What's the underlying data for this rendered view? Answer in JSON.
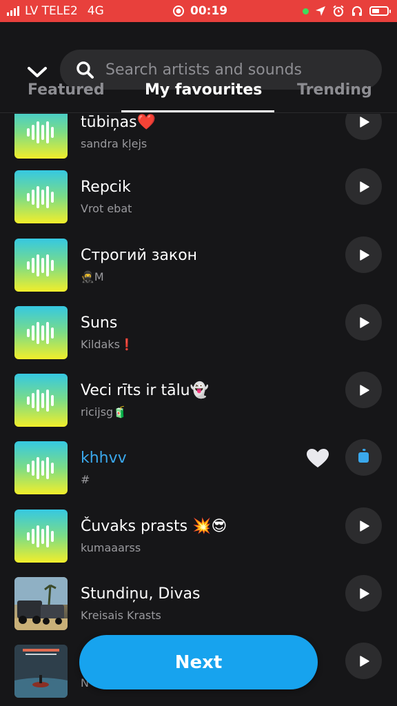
{
  "status_bar": {
    "carrier": "LV TELE2",
    "network": "4G",
    "time": "00:19"
  },
  "search": {
    "placeholder": "Search artists and sounds"
  },
  "tabs": [
    {
      "label": "Featured"
    },
    {
      "label": "My favourites"
    },
    {
      "label": "Trending"
    }
  ],
  "sounds": [
    {
      "title": "tūbiņas❤️",
      "artist": "sandra kļejs"
    },
    {
      "title": "Repcik",
      "artist": "Vrot ebat"
    },
    {
      "title": "Строгий закон",
      "artist": "🥷M"
    },
    {
      "title": "Suns",
      "artist": "Kildaks❗"
    },
    {
      "title": "Veci rīts ir tālu👻",
      "artist": "ricijsg🧃"
    },
    {
      "title": "khhvv",
      "artist": "#"
    },
    {
      "title": "Čuvaks prasts 💥😎",
      "artist": "kumaaarss"
    },
    {
      "title": "Stundiņu, Divas",
      "artist": "Kreisais Krasts"
    },
    {
      "title": "",
      "artist": "N"
    }
  ],
  "next_button": {
    "label": "Next"
  },
  "colors": {
    "status_bar": "#e8403c",
    "background": "#161618",
    "accent": "#17a3ee",
    "highlight_text": "#3aa8ec"
  }
}
